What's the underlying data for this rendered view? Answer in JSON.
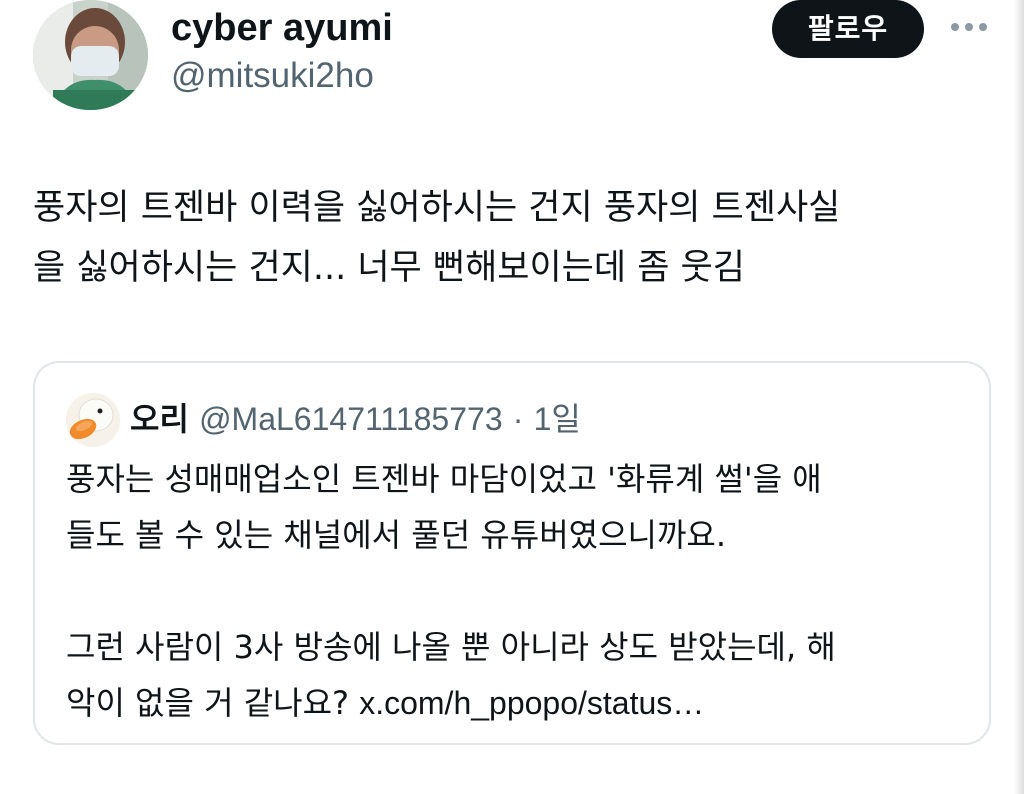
{
  "author": {
    "display_name": "cyber ayumi",
    "handle": "@mitsuki2ho"
  },
  "actions": {
    "follow_label": "팔로우",
    "more_icon": "more-horizontal-icon"
  },
  "tweet": {
    "text_line1": "풍자의 트젠바 이력을 싫어하시는 건지 풍자의 트젠사실",
    "text_line2": "을 싫어하시는 건지... 너무 뻔해보이는데 좀 웃김"
  },
  "quote": {
    "avatar_icon": "duck-avatar-icon",
    "name": "오리",
    "handle": "@MaL614711185773",
    "separator": "·",
    "time": "1일",
    "line1": "풍자는 성매매업소인 트젠바 마담이었고 '화류계 썰'을 애",
    "line2": "들도 볼 수 있는 채널에서 풀던 유튜버였으니까요.",
    "line3": "그런 사람이 3사 방송에 나올 뿐 아니라 상도 받았는데, 해",
    "line4_prefix": "악이 없을 거 같나요? ",
    "link": "x.com/h_ppopo/status…"
  },
  "colors": {
    "text_primary": "#0f1419",
    "text_secondary": "#536471",
    "button_bg": "#0f1419",
    "border": "#e1e5e8"
  }
}
